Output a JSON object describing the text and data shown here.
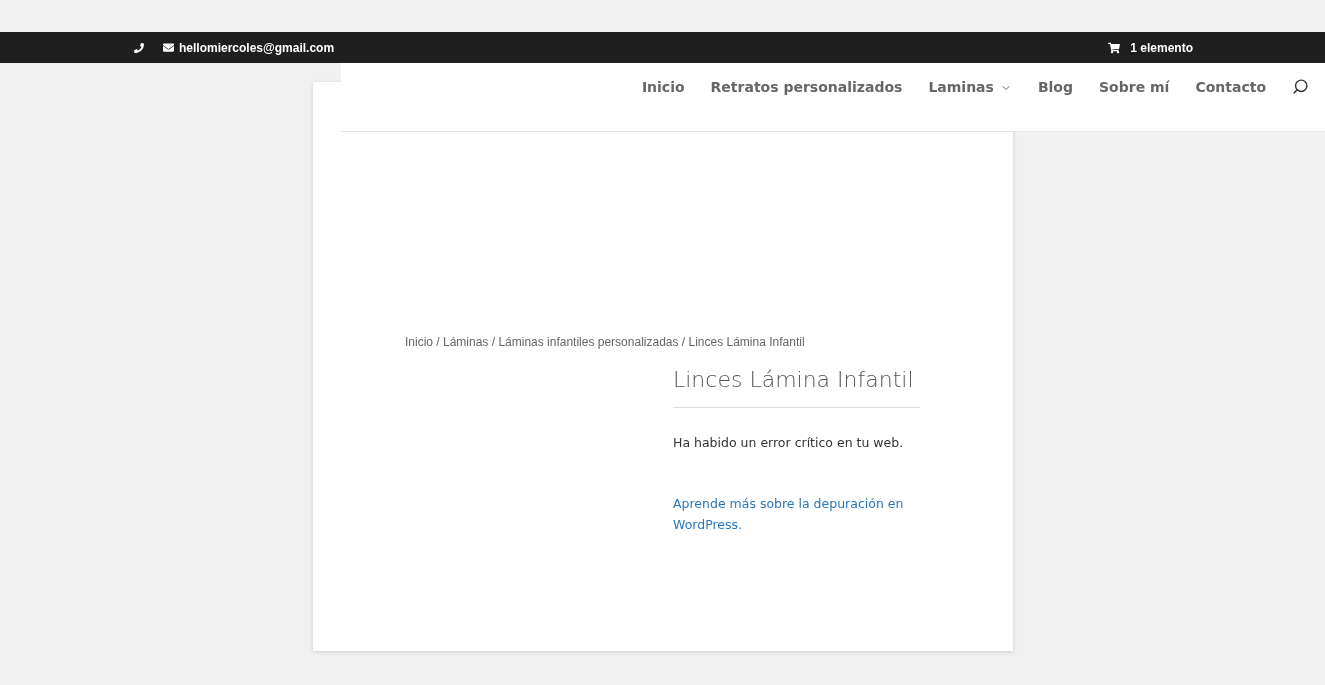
{
  "top_bar": {
    "email": "hellomiercoles@gmail.com",
    "cart": "1 elemento"
  },
  "nav": {
    "items": [
      {
        "label": "Inicio",
        "dropdown": false
      },
      {
        "label": "Retratos personalizados",
        "dropdown": false
      },
      {
        "label": "Laminas",
        "dropdown": true
      },
      {
        "label": "Blog",
        "dropdown": false
      },
      {
        "label": "Sobre mí",
        "dropdown": false
      },
      {
        "label": "Contacto",
        "dropdown": false
      }
    ]
  },
  "breadcrumb": "Inicio / Láminas / Láminas infantiles personalizadas / Linces Lámina Infantil",
  "product": {
    "title": "Linces Lámina Infantil",
    "error": "Ha habido un error crítico en tu web.",
    "link": "Aprende más sobre la depuración en WordPress."
  }
}
